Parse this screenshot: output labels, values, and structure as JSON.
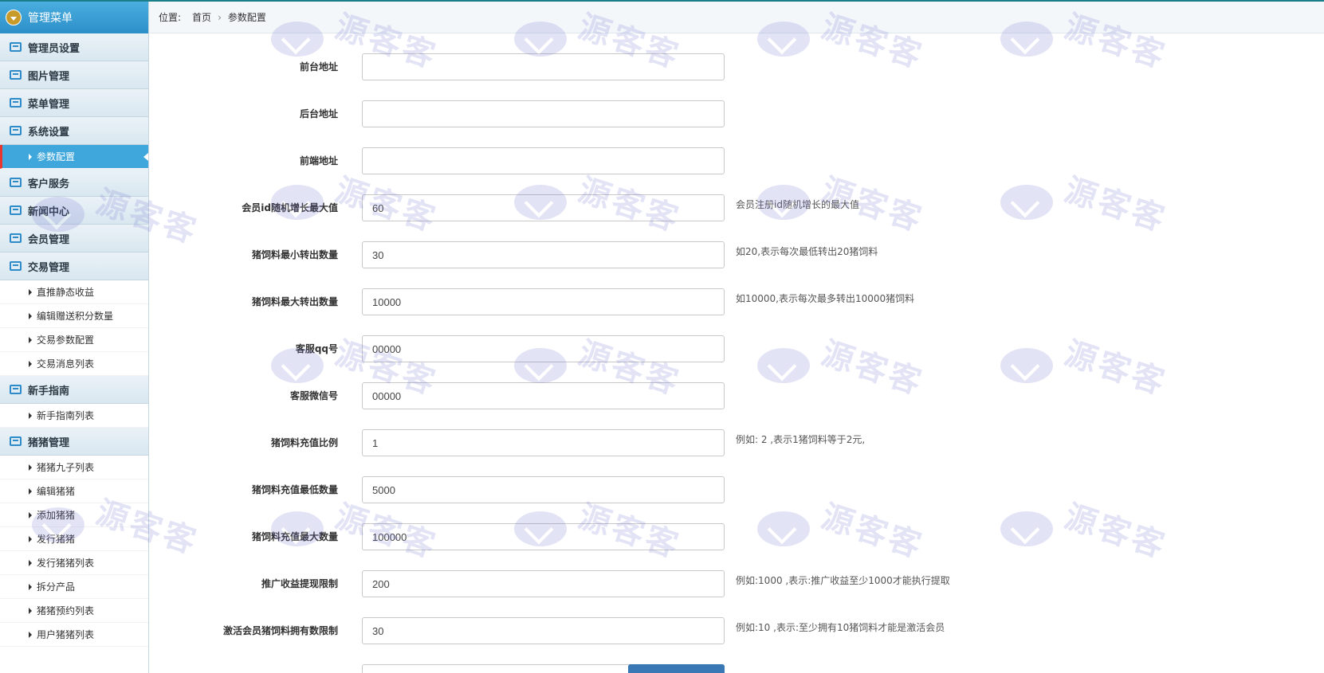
{
  "sidebar": {
    "title": "管理菜单",
    "sections": [
      {
        "label": "管理员设置",
        "items": []
      },
      {
        "label": "图片管理",
        "items": []
      },
      {
        "label": "菜单管理",
        "items": []
      },
      {
        "label": "系统设置",
        "items": [
          "参数配置"
        ]
      },
      {
        "label": "客户服务",
        "items": []
      },
      {
        "label": "新闻中心",
        "items": []
      },
      {
        "label": "会员管理",
        "items": []
      },
      {
        "label": "交易管理",
        "items": [
          "直推静态收益",
          "编辑赠送积分数量",
          "交易参数配置",
          "交易消息列表"
        ]
      },
      {
        "label": "新手指南",
        "items": [
          "新手指南列表"
        ]
      },
      {
        "label": "猪猪管理",
        "items": [
          "猪猪九子列表",
          "编辑猪猪",
          "添加猪猪",
          "发行猪猪",
          "发行猪猪列表",
          "拆分产品",
          "猪猪预约列表",
          "用户猪猪列表"
        ]
      }
    ],
    "active_item": "参数配置"
  },
  "breadcrumb": {
    "label": "位置:",
    "items": [
      "首页",
      "参数配置"
    ],
    "separator": "›"
  },
  "form": {
    "fields": [
      {
        "label": "前台地址",
        "value": "",
        "hint": ""
      },
      {
        "label": "后台地址",
        "value": "",
        "hint": ""
      },
      {
        "label": "前端地址",
        "value": "",
        "hint": ""
      },
      {
        "label": "会员id随机增长最大值",
        "value": "60",
        "hint": "会员注册id随机增长的最大值"
      },
      {
        "label": "猪饲料最小转出数量",
        "value": "30",
        "hint": "如20,表示每次最低转出20猪饲料"
      },
      {
        "label": "猪饲料最大转出数量",
        "value": "10000",
        "hint": "如10000,表示每次最多转出10000猪饲料"
      },
      {
        "label": "客服qq号",
        "value": "00000",
        "hint": ""
      },
      {
        "label": "客服微信号",
        "value": "00000",
        "hint": ""
      },
      {
        "label": "猪饲料充值比例",
        "value": "1",
        "hint": "例如: 2 ,表示1猪饲料等于2元,"
      },
      {
        "label": "猪饲料充值最低数量",
        "value": "5000",
        "hint": ""
      },
      {
        "label": "猪饲料充值最大数量",
        "value": "100000",
        "hint": ""
      },
      {
        "label": "推广收益提现限制",
        "value": "200",
        "hint": "例如:1000 ,表示:推广收益至少1000才能执行提取"
      },
      {
        "label": "激活会员猪饲料拥有数限制",
        "value": "30",
        "hint": "例如:10 ,表示:至少拥有10猪饲料才能是激活会员"
      },
      {
        "label": "",
        "value": "",
        "hint": ""
      }
    ]
  },
  "watermark": {
    "text": "源客客",
    "color": "#6b6bd0"
  },
  "colors": {
    "accent": "#3fa7dc",
    "active_marker": "#e8352e",
    "button": "#3a78b5"
  }
}
